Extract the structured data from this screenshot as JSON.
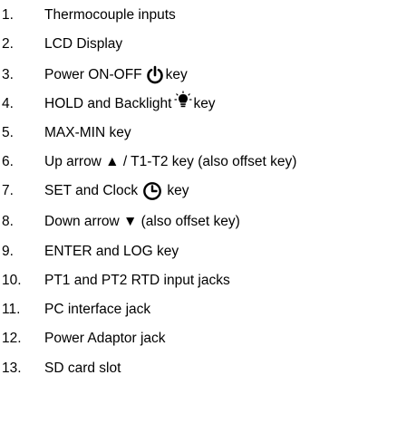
{
  "items": [
    {
      "number": "1.",
      "text": "Thermocouple inputs"
    },
    {
      "number": "2.",
      "text": "LCD Display"
    },
    {
      "number": "3.",
      "text": "Power ON-OFF",
      "icon": "power-icon",
      "after": "key"
    },
    {
      "number": "4.",
      "text": "HOLD and Backlight",
      "icon": "lightbulb-icon",
      "after": "key"
    },
    {
      "number": "5.",
      "text": "MAX-MIN key"
    },
    {
      "number": "6.",
      "text": "Up arrow ▲ / T1-T2 key (also offset key)"
    },
    {
      "number": "7.",
      "text": "SET and Clock",
      "icon": "clock-icon",
      "after": " key"
    },
    {
      "number": "8.",
      "text": "Down arrow ▼ (also offset key)"
    },
    {
      "number": "9.",
      "text": "ENTER and LOG key"
    },
    {
      "number": "10.",
      "text": "PT1 and PT2 RTD input jacks"
    },
    {
      "number": "11.",
      "text": "PC interface jack"
    },
    {
      "number": "12.",
      "text": "Power Adaptor jack"
    },
    {
      "number": "13.",
      "text": "SD card slot"
    }
  ]
}
